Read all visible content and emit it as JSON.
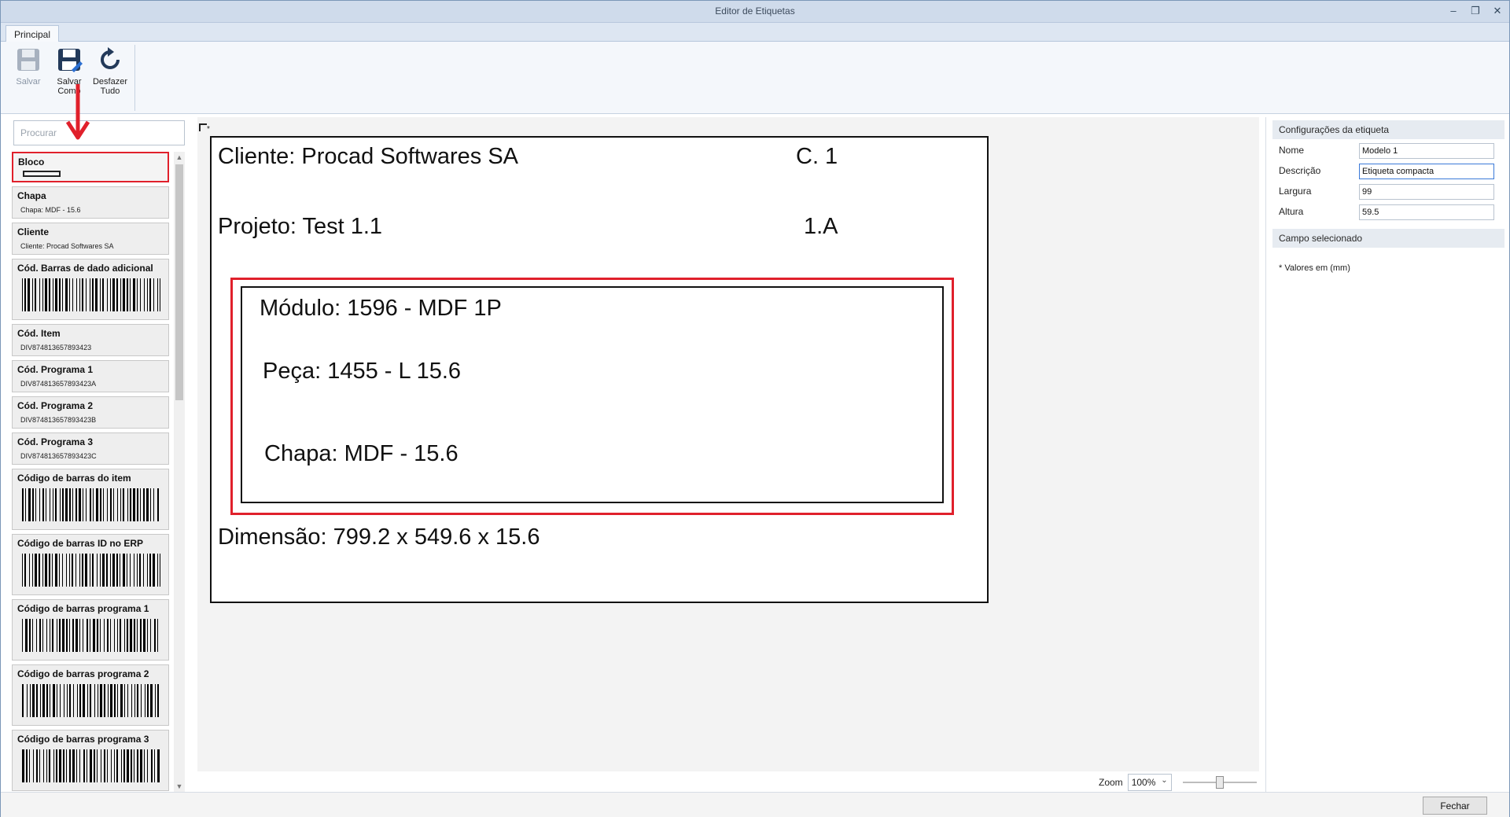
{
  "window": {
    "title": "Editor de Etiquetas",
    "controls": [
      "–",
      "❐",
      "✕"
    ]
  },
  "ribbon": {
    "tab": "Principal",
    "buttons": [
      {
        "icon": "save-icon",
        "line1": "Salvar",
        "line2": "",
        "enabled": false
      },
      {
        "icon": "save-as-icon",
        "line1": "Salvar",
        "line2": "Como",
        "enabled": true
      },
      {
        "icon": "undo-all-icon",
        "line1": "Desfazer",
        "line2": "Tudo",
        "enabled": true
      }
    ]
  },
  "left_panel": {
    "search_placeholder": "Procurar",
    "items": [
      {
        "title": "Bloco",
        "kind": "block"
      },
      {
        "title": "Chapa",
        "kind": "text",
        "sub": "Chapa: MDF - 15.6"
      },
      {
        "title": "Cliente",
        "kind": "text",
        "sub": "Cliente: Procad Softwares SA"
      },
      {
        "title": "Cód. Barras de dado adicional",
        "kind": "barcode"
      },
      {
        "title": "Cód. Item",
        "kind": "text",
        "sub": "DIV874813657893423"
      },
      {
        "title": "Cód. Programa 1",
        "kind": "text",
        "sub": "DIV874813657893423A"
      },
      {
        "title": "Cód. Programa 2",
        "kind": "text",
        "sub": "DIV874813657893423B"
      },
      {
        "title": "Cód. Programa 3",
        "kind": "text",
        "sub": "DIV874813657893423C"
      },
      {
        "title": "Código de barras do item",
        "kind": "barcode"
      },
      {
        "title": "Código de barras ID no ERP",
        "kind": "barcode"
      },
      {
        "title": "Código de barras programa 1",
        "kind": "barcode"
      },
      {
        "title": "Código de barras programa 2",
        "kind": "barcode"
      },
      {
        "title": "Código de barras programa 3",
        "kind": "barcode"
      }
    ]
  },
  "canvas": {
    "origin": "*",
    "cliente": "Cliente: Procad Softwares SA",
    "c1": "C. 1",
    "projeto": "Projeto: Test 1.1",
    "one_a": "1.A",
    "modulo": "Módulo: 1596 - MDF 1P",
    "peca": "Peça: 1455 - L 15.6",
    "chapa": "Chapa: MDF - 15.6",
    "dimensao": "Dimensão: 799.2 x 549.6 x 15.6"
  },
  "zoom": {
    "label": "Zoom",
    "value": "100%",
    "level": 0.5
  },
  "right_panel": {
    "config_header": "Configurações da etiqueta",
    "fields": {
      "nome_label": "Nome",
      "nome_value": "Modelo 1",
      "descricao_label": "Descrição",
      "descricao_value": "Etiqueta compacta",
      "largura_label": "Largura",
      "largura_value": "99",
      "altura_label": "Altura",
      "altura_value": "59.5"
    },
    "selected_header": "Campo selecionado",
    "note": "* Valores em (mm)"
  },
  "footer": {
    "close_label": "Fechar"
  },
  "colors": {
    "highlight_red": "#e0202b",
    "accent_blue": "#3b7ad8"
  }
}
